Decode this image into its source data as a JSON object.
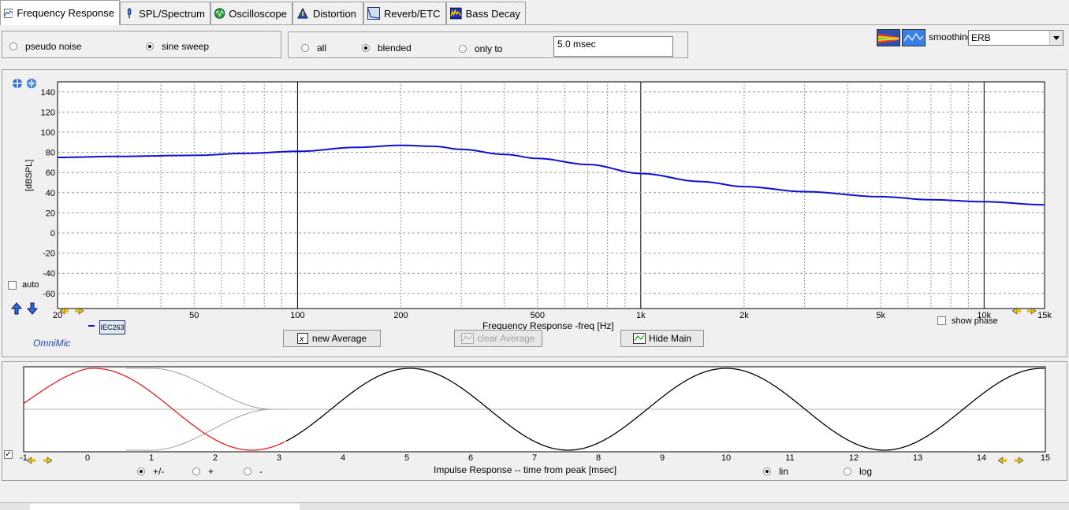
{
  "tabs": [
    {
      "label": "Frequency Response",
      "icon": "frequency-response-icon",
      "active": true
    },
    {
      "label": "SPL/Spectrum",
      "icon": "spl-meter-icon",
      "active": false
    },
    {
      "label": "Oscilloscope",
      "icon": "oscilloscope-icon",
      "active": false
    },
    {
      "label": "Distortion",
      "icon": "distortion-icon",
      "active": false
    },
    {
      "label": "Reverb/ETC",
      "icon": "reverb-icon",
      "active": false
    },
    {
      "label": "Bass Decay",
      "icon": "bass-decay-icon",
      "active": false
    }
  ],
  "signal": {
    "options": [
      {
        "label": "pseudo noise",
        "selected": false
      },
      {
        "label": "sine sweep",
        "selected": true
      }
    ]
  },
  "window": {
    "options": [
      {
        "label": "all",
        "selected": false
      },
      {
        "label": "blended",
        "selected": true
      },
      {
        "label": "only to",
        "selected": false
      }
    ],
    "time_value": "5.0 msec"
  },
  "smoothing": {
    "label": "smoothing",
    "value": "ERB"
  },
  "freq_chart": {
    "auto_label": "auto",
    "ylabel": "[dBSPL]",
    "xlabel": "Frequency Response -freq [Hz]",
    "mic_label": "OmniMic",
    "legend_item": "IEC263",
    "show_phase_label": "show phase",
    "buttons": {
      "new_average": "new Average",
      "clear_average": "clear Average",
      "hide_main": "Hide Main"
    }
  },
  "impulse_chart": {
    "xlabel": "Impulse Response  -- time from peak [msec]",
    "polarity": [
      {
        "label": "+/-",
        "selected": true
      },
      {
        "label": "+",
        "selected": false
      },
      {
        "label": "-",
        "selected": false
      }
    ],
    "scale": [
      {
        "label": "lin",
        "selected": true
      },
      {
        "label": "log",
        "selected": false
      }
    ]
  },
  "colors": {
    "curve": "#1010d0",
    "impulse_main": "#000000",
    "impulse_window": "#e02020",
    "window_fade": "#a0a0a0"
  },
  "chart_data": [
    {
      "type": "line",
      "title": "",
      "xlabel": "Frequency Response -freq [Hz]",
      "ylabel": "[dBSPL]",
      "xscale": "log",
      "xlim": [
        20,
        15000
      ],
      "ylim": [
        -75,
        150
      ],
      "xticks": [
        {
          "v": 20,
          "label": "20"
        },
        {
          "v": 50,
          "label": "50"
        },
        {
          "v": 100,
          "label": "100"
        },
        {
          "v": 200,
          "label": "200"
        },
        {
          "v": 500,
          "label": "500"
        },
        {
          "v": 1000,
          "label": "1k"
        },
        {
          "v": 2000,
          "label": "2k"
        },
        {
          "v": 5000,
          "label": "5k"
        },
        {
          "v": 10000,
          "label": "10k"
        },
        {
          "v": 15000,
          "label": "15k"
        }
      ],
      "yticks": [
        140,
        120,
        100,
        80,
        60,
        40,
        20,
        0,
        -20,
        -40,
        -60
      ],
      "grid": true,
      "series": [
        {
          "name": "IEC263",
          "x": [
            20,
            30,
            50,
            70,
            100,
            150,
            200,
            250,
            300,
            400,
            500,
            700,
            1000,
            1500,
            2000,
            3000,
            5000,
            7000,
            10000,
            15000
          ],
          "y": [
            75,
            76,
            77,
            79,
            81,
            85,
            87,
            86,
            83,
            78,
            74,
            68,
            59,
            51,
            46,
            41,
            36,
            33,
            31,
            28
          ]
        }
      ]
    },
    {
      "type": "line",
      "title": "",
      "xlabel": "Impulse Response  -- time from peak [msec]",
      "ylabel": "",
      "xlim": [
        -1,
        15
      ],
      "xticks": [
        -1,
        0,
        1,
        2,
        3,
        4,
        5,
        6,
        7,
        8,
        9,
        10,
        11,
        12,
        13,
        14,
        15
      ],
      "series": [
        {
          "name": "",
          "period_msec": 4.95,
          "phase_peak_msec": 0.1,
          "amplitude": 1.0
        }
      ]
    }
  ]
}
